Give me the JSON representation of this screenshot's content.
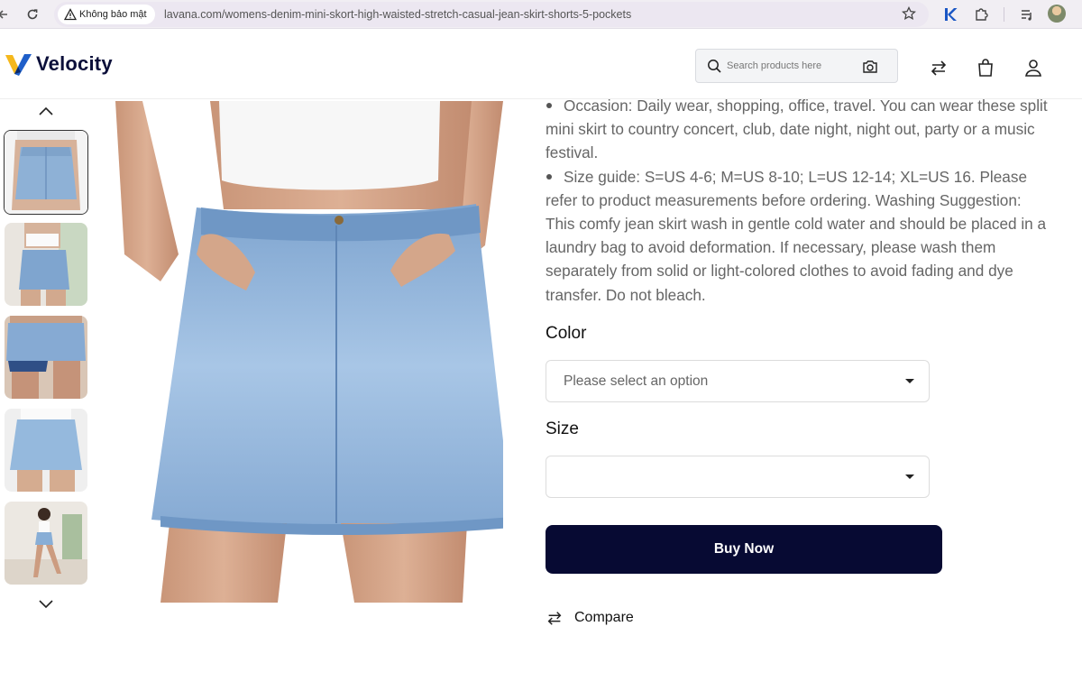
{
  "browser": {
    "security_label": "Không bảo mật",
    "url": "lavana.com/womens-denim-mini-skort-high-waisted-stretch-casual-jean-skirt-shorts-5-pockets"
  },
  "header": {
    "brand": "Velocity",
    "search_placeholder": "Search products here"
  },
  "gallery": {
    "thumbnails": [
      "thumb-1",
      "thumb-2",
      "thumb-3",
      "thumb-4",
      "thumb-5"
    ],
    "active_index": 0
  },
  "product": {
    "description": [
      "Occasion: Daily wear, shopping, office, travel. You can wear these split mini skirt to country concert, club, date night, night out, party or a music festival.",
      "Size guide: S=US 4-6; M=US 8-10; L=US 12-14; XL=US 16. Please refer to product measurements before ordering. Washing Suggestion: This comfy jean skirt wash in gentle cold water and should be placed in a laundry bag to avoid deformation. If necessary, please wash them separately from solid or light-colored clothes to avoid fading and dye transfer. Do not bleach."
    ],
    "color_label": "Color",
    "color_value": "Please select an option",
    "size_label": "Size",
    "size_value": "",
    "buy_label": "Buy Now",
    "compare_label": "Compare"
  },
  "colors": {
    "buy_button": "#070a33",
    "brand_navy": "#0b0f3a",
    "logo_yellow": "#f5b81c",
    "logo_blue": "#1f5fc9"
  }
}
